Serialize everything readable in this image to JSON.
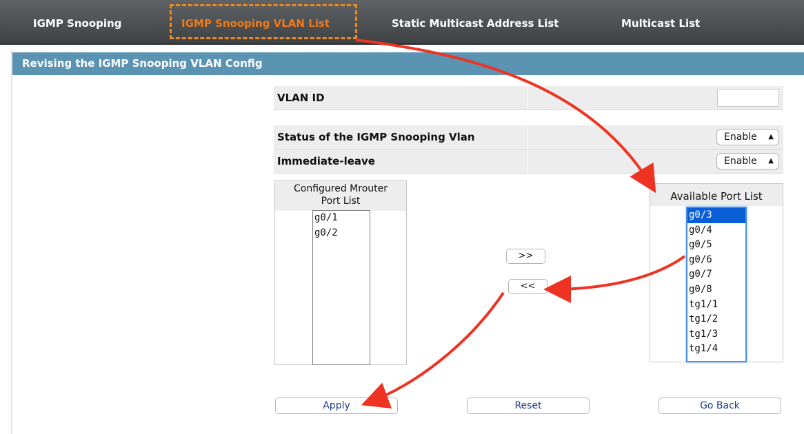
{
  "tabs": [
    {
      "label": "IGMP Snooping",
      "active": false
    },
    {
      "label": "IGMP Snooping VLAN List",
      "active": true
    },
    {
      "label": "Static Multicast Address List",
      "active": false
    },
    {
      "label": "Multicast List",
      "active": false
    }
  ],
  "section_title": "Revising the IGMP Snooping VLAN Config",
  "form": {
    "vlan_id_label": "VLAN ID",
    "vlan_id_value": "",
    "status_label": "Status of the IGMP Snooping Vlan",
    "status_value": "Enable",
    "immediate_leave_label": "Immediate-leave",
    "immediate_leave_value": "Enable"
  },
  "configured_ports": {
    "header_line1": "Configured Mrouter",
    "header_line2": "Port List",
    "items": [
      "g0/1",
      "g0/2"
    ]
  },
  "available_ports": {
    "header": "Available Port List",
    "items": [
      "g0/3",
      "g0/4",
      "g0/5",
      "g0/6",
      "g0/7",
      "g0/8",
      "tg1/1",
      "tg1/2",
      "tg1/3",
      "tg1/4"
    ],
    "selected": "g0/3"
  },
  "transfer": {
    "add_label": ">>",
    "remove_label": "<<"
  },
  "actions": {
    "apply_label": "Apply",
    "reset_label": "Reset",
    "back_label": "Go Back"
  },
  "colors": {
    "accent_tab": "#f07a1a",
    "section_bar": "#5b93b3",
    "annotation_arrow": "#ee3322"
  }
}
